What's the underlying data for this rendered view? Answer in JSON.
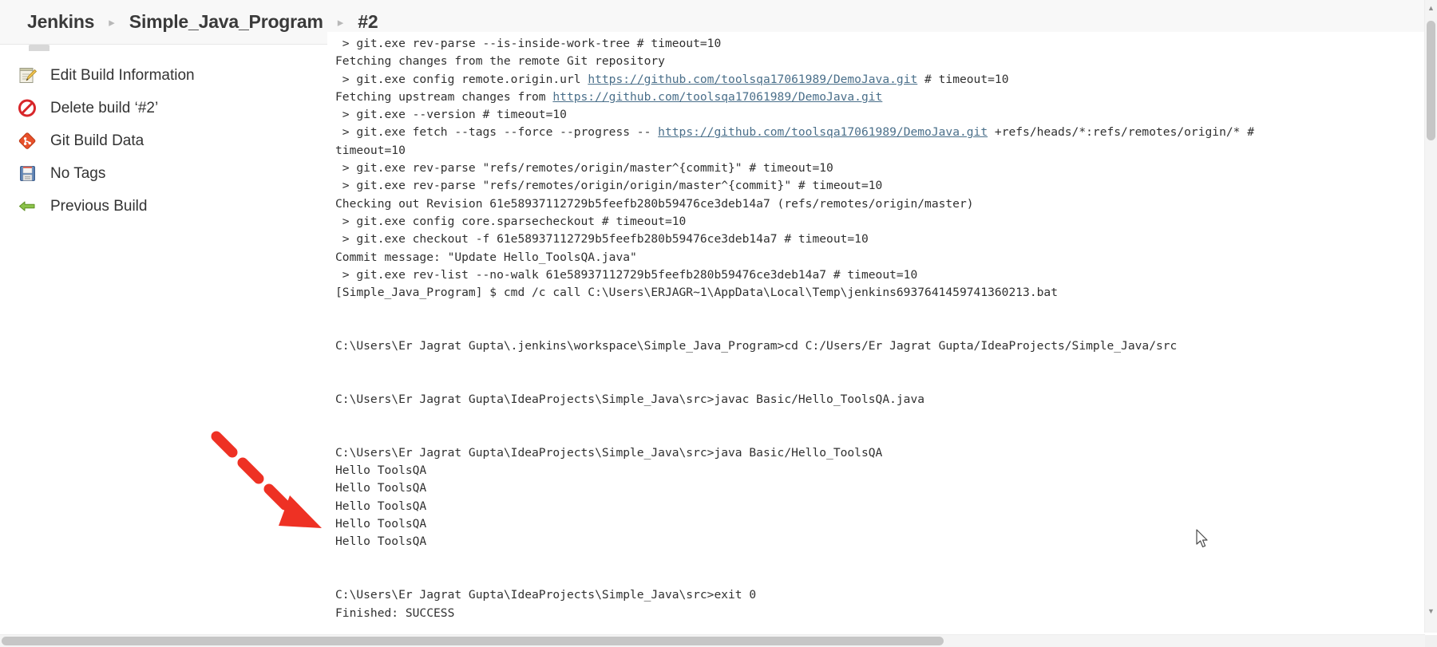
{
  "breadcrumb": {
    "items": [
      {
        "label": "Jenkins"
      },
      {
        "label": "Simple_Java_Program"
      },
      {
        "label": "#2"
      }
    ],
    "separator": "▸"
  },
  "sidebar": {
    "items": [
      {
        "label": "Edit Build Information",
        "icon": "edit-notepad-icon"
      },
      {
        "label": "Delete build ‘#2’",
        "icon": "delete-forbidden-icon"
      },
      {
        "label": "Git Build Data",
        "icon": "git-diamond-icon"
      },
      {
        "label": "No Tags",
        "icon": "floppy-disk-icon"
      },
      {
        "label": "Previous Build",
        "icon": "green-arrow-icon"
      }
    ]
  },
  "console": {
    "lines": [
      {
        "segments": [
          {
            "text": " > git.exe rev-parse --is-inside-work-tree # timeout=10"
          }
        ]
      },
      {
        "segments": [
          {
            "text": "Fetching changes from the remote Git repository"
          }
        ]
      },
      {
        "segments": [
          {
            "text": " > git.exe config remote.origin.url "
          },
          {
            "text": "https://github.com/toolsqa17061989/DemoJava.git",
            "link": true
          },
          {
            "text": " # timeout=10"
          }
        ]
      },
      {
        "segments": [
          {
            "text": "Fetching upstream changes from "
          },
          {
            "text": "https://github.com/toolsqa17061989/DemoJava.git",
            "link": true
          }
        ]
      },
      {
        "segments": [
          {
            "text": " > git.exe --version # timeout=10"
          }
        ]
      },
      {
        "segments": [
          {
            "text": " > git.exe fetch --tags --force --progress -- "
          },
          {
            "text": "https://github.com/toolsqa17061989/DemoJava.git",
            "link": true
          },
          {
            "text": " +refs/heads/*:refs/remotes/origin/* #"
          }
        ]
      },
      {
        "segments": [
          {
            "text": "timeout=10"
          }
        ]
      },
      {
        "segments": [
          {
            "text": " > git.exe rev-parse \"refs/remotes/origin/master^{commit}\" # timeout=10"
          }
        ]
      },
      {
        "segments": [
          {
            "text": " > git.exe rev-parse \"refs/remotes/origin/origin/master^{commit}\" # timeout=10"
          }
        ]
      },
      {
        "segments": [
          {
            "text": "Checking out Revision 61e58937112729b5feefb280b59476ce3deb14a7 (refs/remotes/origin/master)"
          }
        ]
      },
      {
        "segments": [
          {
            "text": " > git.exe config core.sparsecheckout # timeout=10"
          }
        ]
      },
      {
        "segments": [
          {
            "text": " > git.exe checkout -f 61e58937112729b5feefb280b59476ce3deb14a7 # timeout=10"
          }
        ]
      },
      {
        "segments": [
          {
            "text": "Commit message: \"Update Hello_ToolsQA.java\""
          }
        ]
      },
      {
        "segments": [
          {
            "text": " > git.exe rev-list --no-walk 61e58937112729b5feefb280b59476ce3deb14a7 # timeout=10"
          }
        ]
      },
      {
        "segments": [
          {
            "text": "[Simple_Java_Program] $ cmd /c call C:\\Users\\ERJAGR~1\\AppData\\Local\\Temp\\jenkins6937641459741360213.bat"
          }
        ]
      },
      {
        "segments": [
          {
            "text": ""
          }
        ]
      },
      {
        "segments": [
          {
            "text": ""
          }
        ]
      },
      {
        "segments": [
          {
            "text": "C:\\Users\\Er Jagrat Gupta\\.jenkins\\workspace\\Simple_Java_Program>cd C:/Users/Er Jagrat Gupta/IdeaProjects/Simple_Java/src"
          }
        ]
      },
      {
        "segments": [
          {
            "text": ""
          }
        ]
      },
      {
        "segments": [
          {
            "text": ""
          }
        ]
      },
      {
        "segments": [
          {
            "text": "C:\\Users\\Er Jagrat Gupta\\IdeaProjects\\Simple_Java\\src>javac Basic/Hello_ToolsQA.java"
          }
        ]
      },
      {
        "segments": [
          {
            "text": ""
          }
        ]
      },
      {
        "segments": [
          {
            "text": ""
          }
        ]
      },
      {
        "segments": [
          {
            "text": "C:\\Users\\Er Jagrat Gupta\\IdeaProjects\\Simple_Java\\src>java Basic/Hello_ToolsQA"
          }
        ]
      },
      {
        "segments": [
          {
            "text": "Hello ToolsQA"
          }
        ]
      },
      {
        "segments": [
          {
            "text": "Hello ToolsQA"
          }
        ]
      },
      {
        "segments": [
          {
            "text": "Hello ToolsQA"
          }
        ]
      },
      {
        "segments": [
          {
            "text": "Hello ToolsQA"
          }
        ]
      },
      {
        "segments": [
          {
            "text": "Hello ToolsQA"
          }
        ]
      },
      {
        "segments": [
          {
            "text": ""
          }
        ]
      },
      {
        "segments": [
          {
            "text": ""
          }
        ]
      },
      {
        "segments": [
          {
            "text": "C:\\Users\\Er Jagrat Gupta\\IdeaProjects\\Simple_Java\\src>exit 0"
          }
        ]
      },
      {
        "segments": [
          {
            "text": "Finished: SUCCESS"
          }
        ]
      }
    ]
  },
  "annotation": {
    "type": "dashed-arrow",
    "color": "#ee3124",
    "points_to": "Finished: SUCCESS"
  },
  "colors": {
    "link": "#4a6f8a",
    "console_text": "#303030",
    "header_bg": "#f8f8f8",
    "annotation_red": "#ee3124",
    "scroll_thumb": "#c6c6c6"
  }
}
